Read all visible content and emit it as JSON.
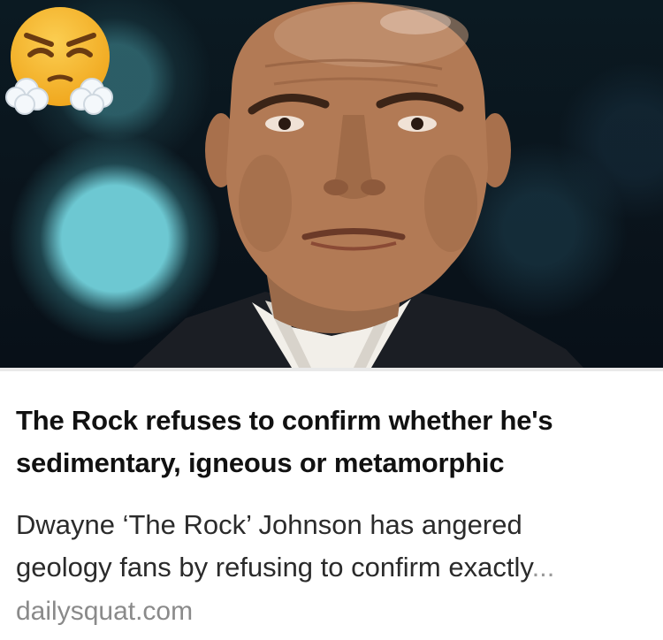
{
  "post": {
    "headline_line1": "The Rock refuses to confirm whether he's",
    "headline_line2": "sedimentary, igneous or metamorphic",
    "description_line1": "Dwayne ‘The Rock’ Johnson has angered",
    "description_line2": "geology fans by refusing to confirm exactly",
    "description_ellipsis": "...",
    "source": "dailysquat.com"
  },
  "photo": {
    "emoji_icon": "face-with-steam-from-nose-icon"
  },
  "colors": {
    "headline": "#111111",
    "description": "#2b2b2b",
    "source": "#8a8a8a",
    "photo_background": "#0b1a22",
    "emoji_face": "#f7b928"
  }
}
